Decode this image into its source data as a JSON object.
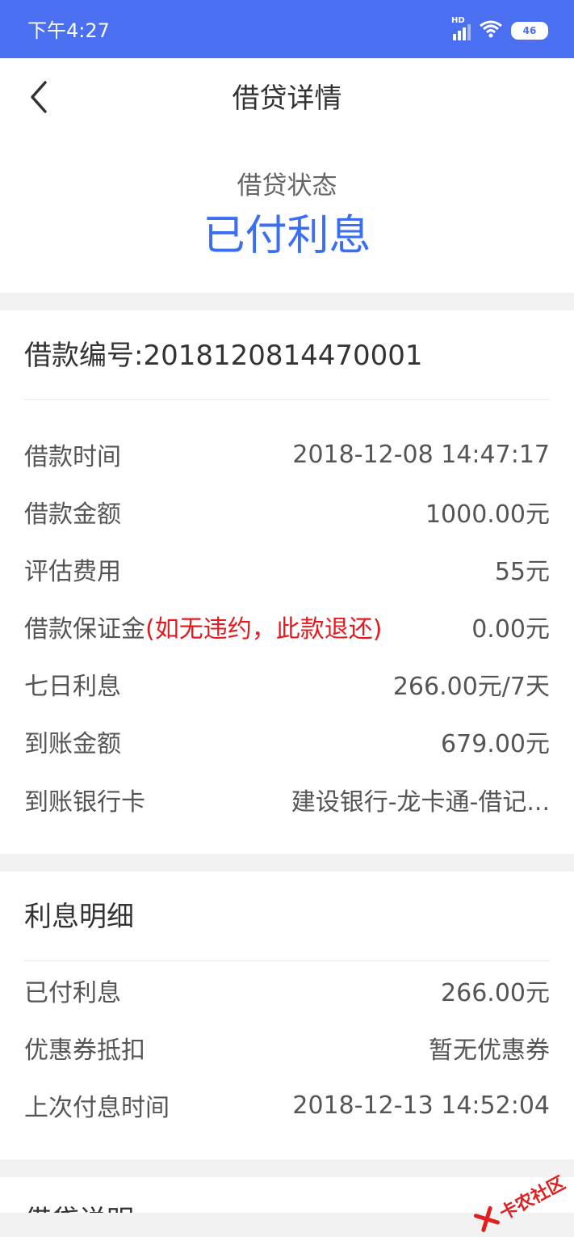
{
  "status_bar": {
    "time": "下午4:27",
    "network": "HD",
    "battery": "46"
  },
  "nav": {
    "title": "借贷详情"
  },
  "loan_status": {
    "label": "借贷状态",
    "value": "已付利息"
  },
  "loan_info": {
    "number_text": "借款编号:2018120814470001",
    "rows": [
      {
        "label": "借款时间",
        "value": "2018-12-08 14:47:17"
      },
      {
        "label": "借款金额",
        "value": "1000.00元"
      },
      {
        "label": "评估费用",
        "value": "55元"
      },
      {
        "label": "借款保证金",
        "note": "(如无违约，此款退还)",
        "value": "0.00元"
      },
      {
        "label": "七日利息",
        "value": "266.00元/7天"
      },
      {
        "label": "到账金额",
        "value": "679.00元"
      },
      {
        "label": "到账银行卡",
        "value": "建设银行-龙卡通-借记..."
      }
    ]
  },
  "interest_details": {
    "title": "利息明细",
    "rows": [
      {
        "label": "已付利息",
        "value": "266.00元"
      },
      {
        "label": "优惠券抵扣",
        "value": "暂无优惠券"
      },
      {
        "label": "上次付息时间",
        "value": "2018-12-13 14:52:04"
      }
    ]
  },
  "loan_notes": {
    "title": "借贷说明"
  },
  "watermark": {
    "text": "卡农社区"
  },
  "colors": {
    "status_bar": "#4a6ff0",
    "accent": "#3b6df5",
    "warning": "#e8191c"
  }
}
